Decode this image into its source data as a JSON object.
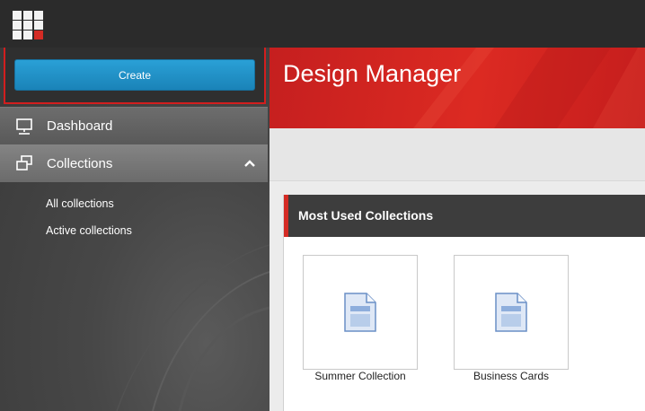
{
  "topbar": {
    "apps_icon": "app-grid-icon"
  },
  "sidebar": {
    "create_label": "Create",
    "nav": [
      {
        "label": "Dashboard",
        "icon": "presentation-board-icon"
      },
      {
        "label": "Collections",
        "icon": "collections-icon",
        "expanded": true
      }
    ],
    "sub_items": [
      "All collections",
      "Active collections"
    ]
  },
  "main": {
    "title": "Design Manager",
    "panel_title": "Most Used Collections",
    "tiles": [
      {
        "label": "Summer Collection",
        "icon": "document-icon"
      },
      {
        "label": "Business Cards",
        "icon": "document-icon"
      }
    ]
  },
  "colors": {
    "accent_red": "#d42b24",
    "button_blue": "#1f90c7",
    "sidebar_dark": "#474747"
  }
}
